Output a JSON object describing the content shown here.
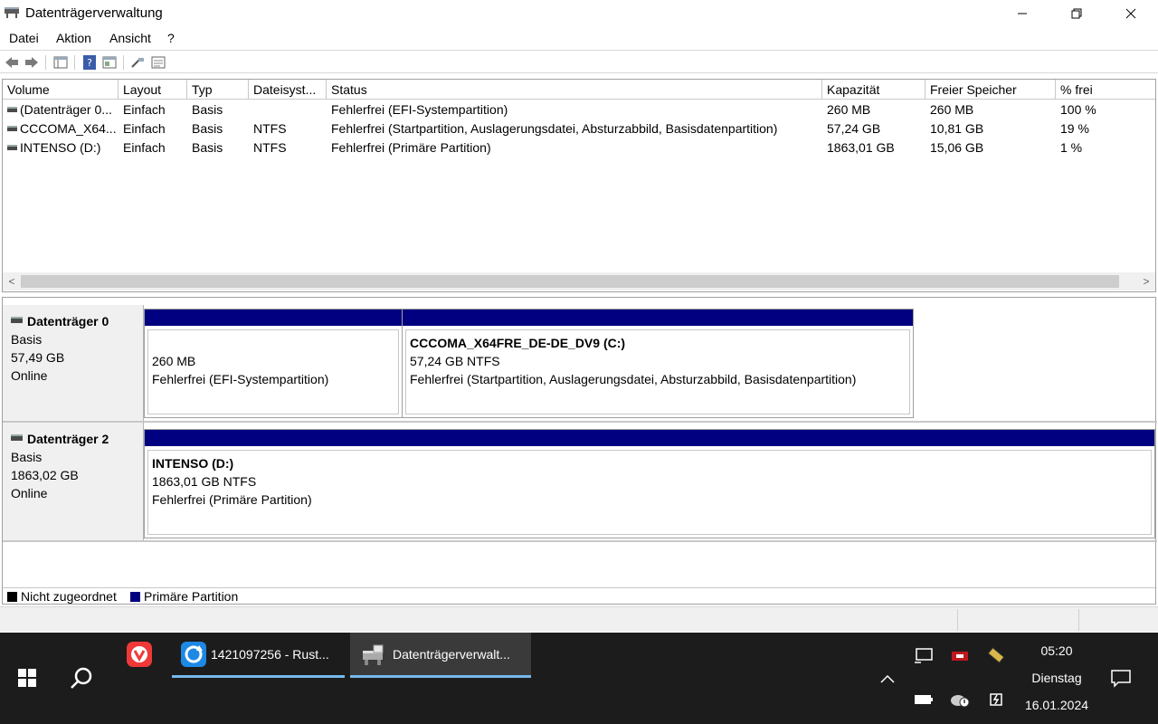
{
  "window": {
    "title": "Datenträgerverwaltung",
    "minimize_icon": "minimize-icon",
    "maximize_icon": "restore-icon",
    "close_icon": "close-icon"
  },
  "menu": [
    "Datei",
    "Aktion",
    "Ansicht",
    "?"
  ],
  "toolbar": {
    "icons": [
      "back-arrow-icon",
      "forward-arrow-icon",
      "console-tree-icon",
      "help-icon",
      "properties-icon",
      "connect-icon",
      "details-icon"
    ]
  },
  "volume_list": {
    "columns": [
      "Volume",
      "Layout",
      "Typ",
      "Dateisyst...",
      "Status",
      "Kapazität",
      "Freier Speicher",
      "% frei"
    ],
    "rows": [
      {
        "volume": "(Datenträger 0...",
        "layout": "Einfach",
        "typ": "Basis",
        "fs": "",
        "status": "Fehlerfrei (EFI-Systempartition)",
        "capacity": "260 MB",
        "free": "260 MB",
        "pct": "100 %"
      },
      {
        "volume": "CCCOMA_X64...",
        "layout": "Einfach",
        "typ": "Basis",
        "fs": "NTFS",
        "status": "Fehlerfrei (Startpartition, Auslagerungsdatei, Absturzabbild, Basisdatenpartition)",
        "capacity": "57,24 GB",
        "free": "10,81 GB",
        "pct": "19 %"
      },
      {
        "volume": "INTENSO (D:)",
        "layout": "Einfach",
        "typ": "Basis",
        "fs": "NTFS",
        "status": "Fehlerfrei (Primäre Partition)",
        "capacity": "1863,01 GB",
        "free": "15,06 GB",
        "pct": "1 %"
      }
    ],
    "scroll_left": "<",
    "scroll_right": ">"
  },
  "disks": [
    {
      "name": "Datenträger 0",
      "type": "Basis",
      "size": "57,49 GB",
      "state": "Online",
      "partitions": [
        {
          "title": "",
          "line1": "260 MB",
          "line2": "Fehlerfrei (EFI-Systempartition)"
        },
        {
          "title": "CCCOMA_X64FRE_DE-DE_DV9  (C:)",
          "line1": "57,24 GB NTFS",
          "line2": "Fehlerfrei (Startpartition, Auslagerungsdatei, Absturzabbild, Basisdatenpartition)"
        }
      ]
    },
    {
      "name": "Datenträger 2",
      "type": "Basis",
      "size": "1863,02 GB",
      "state": "Online",
      "partitions": [
        {
          "title": "INTENSO  (D:)",
          "line1": "1863,01 GB NTFS",
          "line2": "Fehlerfrei (Primäre Partition)"
        }
      ]
    }
  ],
  "legend": [
    {
      "label": "Nicht zugeordnet",
      "color": "#000000"
    },
    {
      "label": "Primäre Partition",
      "color": "#000080"
    }
  ],
  "taskbar": {
    "start_icon": "windows-start-icon",
    "search_icon": "search-icon",
    "apps": [
      {
        "icon": "vivaldi-icon",
        "label": ""
      },
      {
        "icon": "sync-app-icon",
        "label": "1421097256 - Rust..."
      },
      {
        "icon": "disk-management-icon",
        "label": "Datenträgerverwalt..."
      }
    ],
    "tray_icons": [
      "chevron-up-icon",
      "network-icon",
      "antivirus-icon",
      "memory-icon",
      "battery-icon",
      "cloud-icon",
      "power-plug-icon",
      "notification-icon"
    ],
    "clock": {
      "time": "05:20",
      "day": "Dienstag",
      "date": "16.01.2024"
    }
  },
  "colors": {
    "primary_partition": "#000080",
    "taskbar": "#1c1c1c",
    "accent": "#76b9ed"
  }
}
